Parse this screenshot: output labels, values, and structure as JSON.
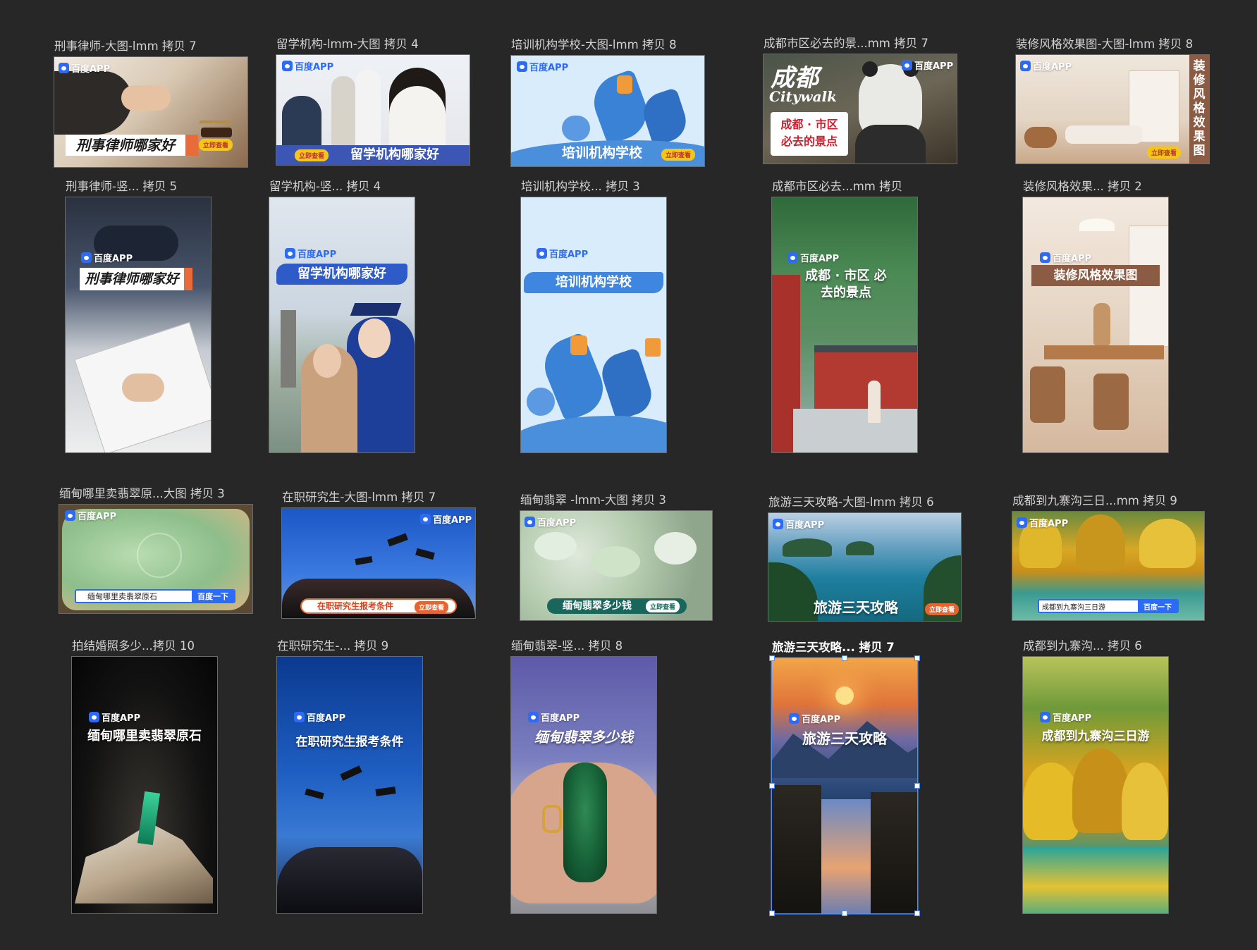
{
  "canvas": {
    "background": "#272727",
    "selection_color": "#4d8ff5"
  },
  "brand": {
    "logo_text": "百度APP",
    "cta_text": "立即查看",
    "search_button": "百度一下"
  },
  "artboards": [
    {
      "title": "刑事律师-大图-lmm 拷贝 7",
      "headline": "刑事律师哪家好"
    },
    {
      "title": "留学机构-lmm-大图 拷贝 4",
      "headline": "留学机构哪家好"
    },
    {
      "title": "培训机构学校-大图-lmm 拷贝 8",
      "headline": "培训机构学校"
    },
    {
      "title": "成都市区必去的景...mm 拷贝 7",
      "headline": "成都 · 市区 必去的景点",
      "script_title": "成都",
      "script_sub": "Citywalk"
    },
    {
      "title": "装修风格效果图-大图-lmm 拷贝 8",
      "headline": "装修风格效果图"
    },
    {
      "title": "刑事律师-竖... 拷贝 5",
      "headline": "刑事律师哪家好"
    },
    {
      "title": "留学机构-竖... 拷贝 4",
      "headline": "留学机构哪家好"
    },
    {
      "title": "培训机构学校... 拷贝 3",
      "headline": "培训机构学校"
    },
    {
      "title": "成都市区必去...mm 拷贝",
      "headline": "成都 · 市区 必去的景点"
    },
    {
      "title": "装修风格效果... 拷贝 2",
      "headline": "装修风格效果图"
    },
    {
      "title": "缅甸哪里卖翡翠原...大图 拷贝 3",
      "headline": "缅甸哪里卖翡翠原石"
    },
    {
      "title": "在职研究生-大图-lmm 拷贝 7",
      "headline": "在职研究生报考条件"
    },
    {
      "title": "缅甸翡翠 -lmm-大图 拷贝 3",
      "headline": "缅甸翡翠多少钱"
    },
    {
      "title": "旅游三天攻略-大图-lmm 拷贝 6",
      "headline": "旅游三天攻略"
    },
    {
      "title": "成都到九寨沟三日...mm 拷贝 9",
      "headline": "成都到九寨沟三日游"
    },
    {
      "title": "拍结婚照多少...拷贝 10",
      "headline": "缅甸哪里卖翡翠原石"
    },
    {
      "title": "在职研究生-... 拷贝 9",
      "headline": "在职研究生报考条件"
    },
    {
      "title": "缅甸翡翠-竖... 拷贝 8",
      "headline": "缅甸翡翠多少钱"
    },
    {
      "title": "旅游三天攻略... 拷贝 7",
      "headline": "旅游三天攻略",
      "selected": true
    },
    {
      "title": "成都到九寨沟... 拷贝 6",
      "headline": "成都到九寨沟三日游"
    }
  ]
}
